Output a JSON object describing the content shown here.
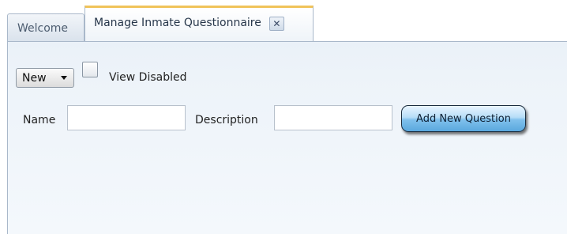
{
  "tabs": [
    {
      "label": "Welcome",
      "active": false
    },
    {
      "label": "Manage Inmate Questionnaire",
      "active": true,
      "closable": true
    }
  ],
  "tab_close_glyph": "✕",
  "filter": {
    "select_value": "New",
    "view_disabled_label": "View Disabled",
    "view_disabled_checked": false
  },
  "form": {
    "name_label": "Name",
    "name_value": "",
    "description_label": "Description",
    "description_value": "",
    "add_button_label": "Add New Question"
  },
  "colors": {
    "active_tab_accent": "#f0c35a",
    "panel_background": "#edf3f9",
    "button_fill": "#7fc0ec"
  }
}
